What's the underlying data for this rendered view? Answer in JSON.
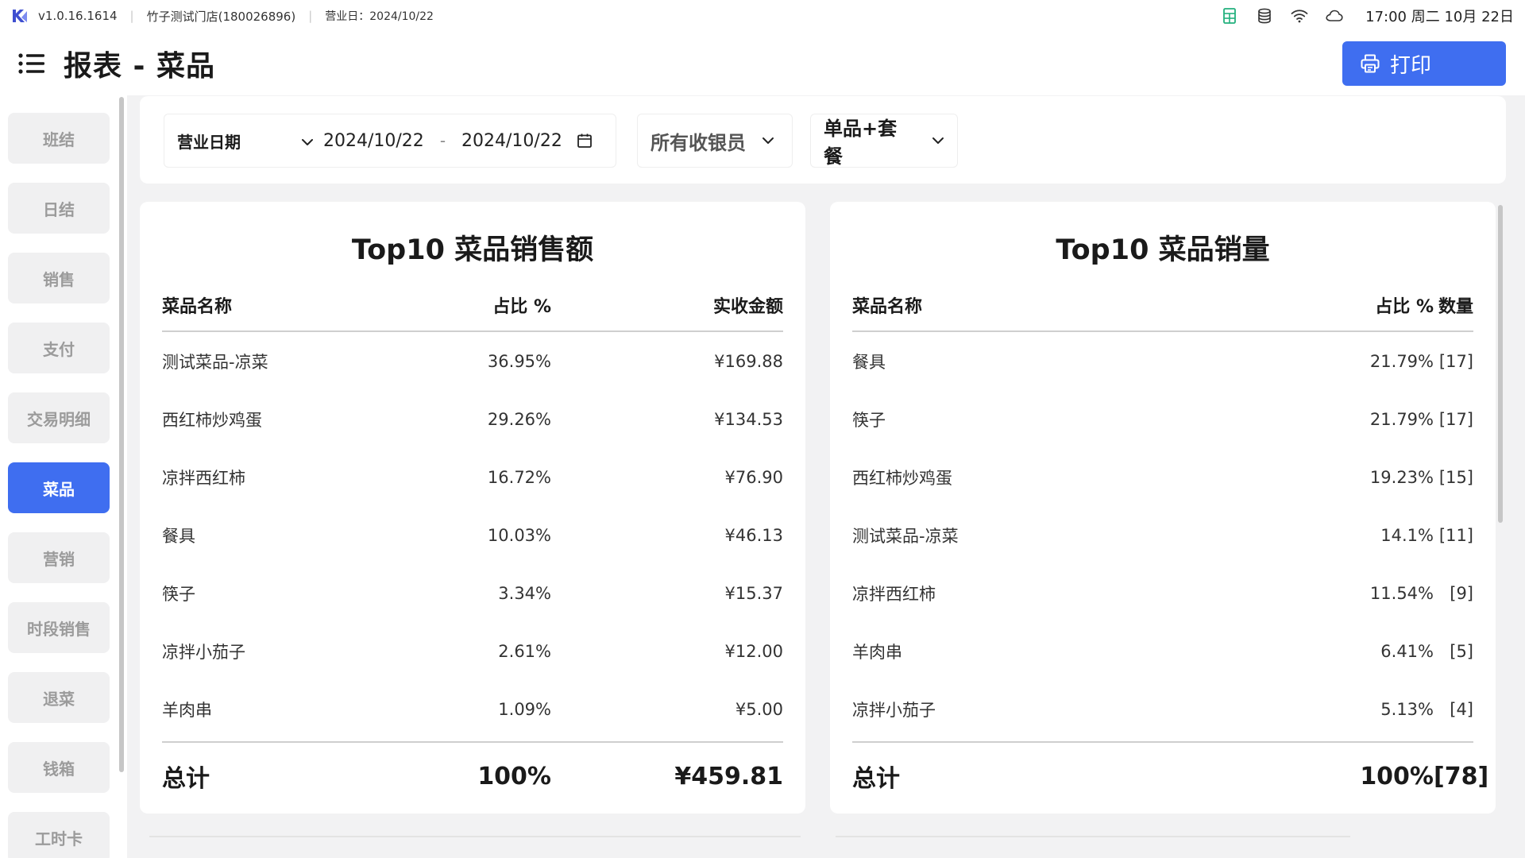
{
  "statusbar": {
    "version": "v1.0.16.1614",
    "store": "竹子测试门店(180026896)",
    "business_day": "营业日：2024/10/22",
    "clock": "17:00 周二 10月 22日",
    "icons": [
      "spreadsheet-icon",
      "database-icon",
      "wifi-icon",
      "cloud-icon"
    ],
    "accent_green": "#22b07d"
  },
  "header": {
    "title": "报表 - 菜品",
    "print_label": "打印"
  },
  "sidebar": {
    "items": [
      {
        "label": "班结",
        "active": false
      },
      {
        "label": "日结",
        "active": false
      },
      {
        "label": "销售",
        "active": false
      },
      {
        "label": "支付",
        "active": false
      },
      {
        "label": "交易明细",
        "active": false
      },
      {
        "label": "菜品",
        "active": true
      },
      {
        "label": "营销",
        "active": false
      },
      {
        "label": "时段销售",
        "active": false
      },
      {
        "label": "退菜",
        "active": false
      },
      {
        "label": "钱箱",
        "active": false
      },
      {
        "label": "工时卡",
        "active": false
      }
    ]
  },
  "filters": {
    "date_type": "营业日期",
    "start_date": "2024/10/22",
    "separator": "-",
    "end_date": "2024/10/22",
    "cashier": "所有收银员",
    "item_type": "单品+套餐"
  },
  "sales_table": {
    "title": "Top10 菜品销售额",
    "columns": [
      "菜品名称",
      "占比 %",
      "实收金额"
    ],
    "rows": [
      [
        "测试菜品-凉菜",
        "36.95%",
        "¥169.88"
      ],
      [
        "西红柿炒鸡蛋",
        "29.26%",
        "¥134.53"
      ],
      [
        "凉拌西红柿",
        "16.72%",
        "¥76.90"
      ],
      [
        "餐具",
        "10.03%",
        "¥46.13"
      ],
      [
        "筷子",
        "3.34%",
        "¥15.37"
      ],
      [
        "凉拌小茄子",
        "2.61%",
        "¥12.00"
      ],
      [
        "羊肉串",
        "1.09%",
        "¥5.00"
      ]
    ],
    "total": [
      "总计",
      "100%",
      "¥459.81"
    ]
  },
  "qty_table": {
    "title": "Top10 菜品销量",
    "columns": [
      "菜品名称",
      "占比 %",
      "数量"
    ],
    "rows": [
      [
        "餐具",
        "21.79%",
        "[17]"
      ],
      [
        "筷子",
        "21.79%",
        "[17]"
      ],
      [
        "西红柿炒鸡蛋",
        "19.23%",
        "[15]"
      ],
      [
        "测试菜品-凉菜",
        "14.1%",
        "[11]"
      ],
      [
        "凉拌西红柿",
        "11.54%",
        "[9]"
      ],
      [
        "羊肉串",
        "6.41%",
        "[5]"
      ],
      [
        "凉拌小茄子",
        "5.13%",
        "[4]"
      ]
    ],
    "total": [
      "总计",
      "100%",
      "[78]"
    ]
  },
  "colors": {
    "accent": "#3f6ef0",
    "background": "#f2f2f3",
    "sidebar_inactive_bg": "#f0f0f1",
    "sidebar_inactive_text": "#9b9b9b"
  }
}
